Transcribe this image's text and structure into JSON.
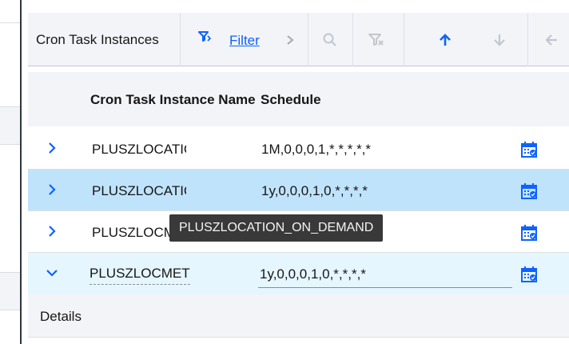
{
  "toolbar": {
    "title": "Cron Task Instances",
    "filter_label": "Filter",
    "icons": [
      "filter-icon",
      "chevron-right-icon",
      "search-icon",
      "clear-filter-icon",
      "arrow-up-icon",
      "arrow-down-icon",
      "arrow-left-icon"
    ],
    "colors": {
      "active": "#0f62fe",
      "disabled": "#c1c7cd"
    }
  },
  "table": {
    "headers": {
      "name": "Cron Task Instance Name",
      "schedule": "Schedule"
    },
    "rows": [
      {
        "name": "PLUSZLOCATIC",
        "schedule": "1M,0,0,0,1,*,*,*,*,*",
        "state": "collapsed"
      },
      {
        "name": "PLUSZLOCATIC",
        "schedule": "1y,0,0,0,1,0,*,*,*,*",
        "state": "selected"
      },
      {
        "name": "PLUSZLOCM",
        "schedule": "",
        "state": "collapsed"
      },
      {
        "name": "PLUSZLOCMETE",
        "schedule": "1y,0,0,0,1,0,*,*,*,*",
        "state": "expanded"
      }
    ],
    "row_icon": "calendar-check-icon",
    "selected_color": "#bfe3fb",
    "expanded_color": "#e5f6ff"
  },
  "details": {
    "label": "Details"
  },
  "tooltip": {
    "text": "PLUSZLOCATION_ON_DEMAND"
  }
}
